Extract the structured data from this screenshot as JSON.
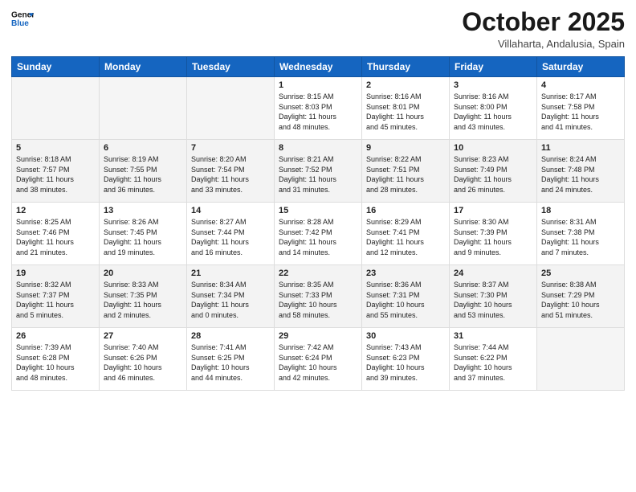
{
  "header": {
    "logo_line1": "General",
    "logo_line2": "Blue",
    "month": "October 2025",
    "location": "Villaharta, Andalusia, Spain"
  },
  "days_of_week": [
    "Sunday",
    "Monday",
    "Tuesday",
    "Wednesday",
    "Thursday",
    "Friday",
    "Saturday"
  ],
  "weeks": [
    [
      {
        "day": "",
        "info": ""
      },
      {
        "day": "",
        "info": ""
      },
      {
        "day": "",
        "info": ""
      },
      {
        "day": "1",
        "info": "Sunrise: 8:15 AM\nSunset: 8:03 PM\nDaylight: 11 hours\nand 48 minutes."
      },
      {
        "day": "2",
        "info": "Sunrise: 8:16 AM\nSunset: 8:01 PM\nDaylight: 11 hours\nand 45 minutes."
      },
      {
        "day": "3",
        "info": "Sunrise: 8:16 AM\nSunset: 8:00 PM\nDaylight: 11 hours\nand 43 minutes."
      },
      {
        "day": "4",
        "info": "Sunrise: 8:17 AM\nSunset: 7:58 PM\nDaylight: 11 hours\nand 41 minutes."
      }
    ],
    [
      {
        "day": "5",
        "info": "Sunrise: 8:18 AM\nSunset: 7:57 PM\nDaylight: 11 hours\nand 38 minutes."
      },
      {
        "day": "6",
        "info": "Sunrise: 8:19 AM\nSunset: 7:55 PM\nDaylight: 11 hours\nand 36 minutes."
      },
      {
        "day": "7",
        "info": "Sunrise: 8:20 AM\nSunset: 7:54 PM\nDaylight: 11 hours\nand 33 minutes."
      },
      {
        "day": "8",
        "info": "Sunrise: 8:21 AM\nSunset: 7:52 PM\nDaylight: 11 hours\nand 31 minutes."
      },
      {
        "day": "9",
        "info": "Sunrise: 8:22 AM\nSunset: 7:51 PM\nDaylight: 11 hours\nand 28 minutes."
      },
      {
        "day": "10",
        "info": "Sunrise: 8:23 AM\nSunset: 7:49 PM\nDaylight: 11 hours\nand 26 minutes."
      },
      {
        "day": "11",
        "info": "Sunrise: 8:24 AM\nSunset: 7:48 PM\nDaylight: 11 hours\nand 24 minutes."
      }
    ],
    [
      {
        "day": "12",
        "info": "Sunrise: 8:25 AM\nSunset: 7:46 PM\nDaylight: 11 hours\nand 21 minutes."
      },
      {
        "day": "13",
        "info": "Sunrise: 8:26 AM\nSunset: 7:45 PM\nDaylight: 11 hours\nand 19 minutes."
      },
      {
        "day": "14",
        "info": "Sunrise: 8:27 AM\nSunset: 7:44 PM\nDaylight: 11 hours\nand 16 minutes."
      },
      {
        "day": "15",
        "info": "Sunrise: 8:28 AM\nSunset: 7:42 PM\nDaylight: 11 hours\nand 14 minutes."
      },
      {
        "day": "16",
        "info": "Sunrise: 8:29 AM\nSunset: 7:41 PM\nDaylight: 11 hours\nand 12 minutes."
      },
      {
        "day": "17",
        "info": "Sunrise: 8:30 AM\nSunset: 7:39 PM\nDaylight: 11 hours\nand 9 minutes."
      },
      {
        "day": "18",
        "info": "Sunrise: 8:31 AM\nSunset: 7:38 PM\nDaylight: 11 hours\nand 7 minutes."
      }
    ],
    [
      {
        "day": "19",
        "info": "Sunrise: 8:32 AM\nSunset: 7:37 PM\nDaylight: 11 hours\nand 5 minutes."
      },
      {
        "day": "20",
        "info": "Sunrise: 8:33 AM\nSunset: 7:35 PM\nDaylight: 11 hours\nand 2 minutes."
      },
      {
        "day": "21",
        "info": "Sunrise: 8:34 AM\nSunset: 7:34 PM\nDaylight: 11 hours\nand 0 minutes."
      },
      {
        "day": "22",
        "info": "Sunrise: 8:35 AM\nSunset: 7:33 PM\nDaylight: 10 hours\nand 58 minutes."
      },
      {
        "day": "23",
        "info": "Sunrise: 8:36 AM\nSunset: 7:31 PM\nDaylight: 10 hours\nand 55 minutes."
      },
      {
        "day": "24",
        "info": "Sunrise: 8:37 AM\nSunset: 7:30 PM\nDaylight: 10 hours\nand 53 minutes."
      },
      {
        "day": "25",
        "info": "Sunrise: 8:38 AM\nSunset: 7:29 PM\nDaylight: 10 hours\nand 51 minutes."
      }
    ],
    [
      {
        "day": "26",
        "info": "Sunrise: 7:39 AM\nSunset: 6:28 PM\nDaylight: 10 hours\nand 48 minutes."
      },
      {
        "day": "27",
        "info": "Sunrise: 7:40 AM\nSunset: 6:26 PM\nDaylight: 10 hours\nand 46 minutes."
      },
      {
        "day": "28",
        "info": "Sunrise: 7:41 AM\nSunset: 6:25 PM\nDaylight: 10 hours\nand 44 minutes."
      },
      {
        "day": "29",
        "info": "Sunrise: 7:42 AM\nSunset: 6:24 PM\nDaylight: 10 hours\nand 42 minutes."
      },
      {
        "day": "30",
        "info": "Sunrise: 7:43 AM\nSunset: 6:23 PM\nDaylight: 10 hours\nand 39 minutes."
      },
      {
        "day": "31",
        "info": "Sunrise: 7:44 AM\nSunset: 6:22 PM\nDaylight: 10 hours\nand 37 minutes."
      },
      {
        "day": "",
        "info": ""
      }
    ]
  ]
}
